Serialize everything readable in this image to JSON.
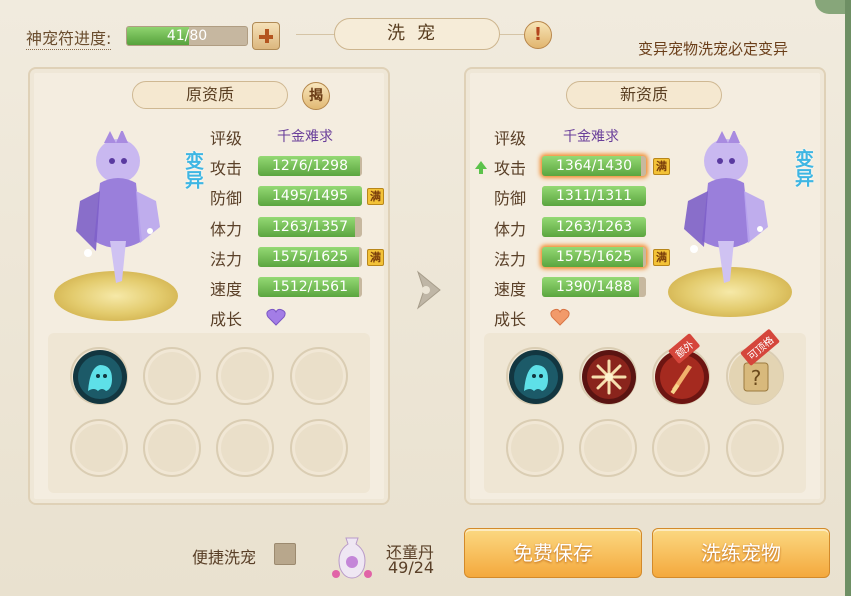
{
  "header": {
    "progress_label": "神宠符进度:",
    "progress_text": "41/80",
    "progress_fraction": 0.5125,
    "title": "洗宠",
    "mutation_note": "变异宠物洗宠必定变异"
  },
  "left_panel": {
    "header": "原资质",
    "reveal_label": "揭",
    "mutation_tag": "变异",
    "stats": [
      {
        "label": "评级",
        "value": "千金难求"
      },
      {
        "label": "攻击",
        "value": "1276/1298",
        "fraction": 0.983,
        "full": false
      },
      {
        "label": "防御",
        "value": "1495/1495",
        "fraction": 1.0,
        "full": true
      },
      {
        "label": "体力",
        "value": "1263/1357",
        "fraction": 0.931,
        "full": false
      },
      {
        "label": "法力",
        "value": "1575/1625",
        "fraction": 0.969,
        "full": true
      },
      {
        "label": "速度",
        "value": "1512/1561",
        "fraction": 0.969,
        "full": false
      },
      {
        "label": "成长",
        "value": "purple-heart-icon"
      }
    ],
    "skills": [
      "ghost-skill-icon",
      "",
      "",
      "",
      "",
      "",
      "",
      ""
    ]
  },
  "right_panel": {
    "header": "新资质",
    "mutation_tag": "变异",
    "stats": [
      {
        "label": "评级",
        "value": "千金难求"
      },
      {
        "label": "攻击",
        "value": "1364/1430",
        "fraction": 0.954,
        "full": true,
        "improved": true
      },
      {
        "label": "防御",
        "value": "1311/1311",
        "fraction": 1.0,
        "full": false
      },
      {
        "label": "体力",
        "value": "1263/1263",
        "fraction": 1.0,
        "full": false
      },
      {
        "label": "法力",
        "value": "1575/1625",
        "fraction": 0.969,
        "full": true
      },
      {
        "label": "速度",
        "value": "1390/1488",
        "fraction": 0.934,
        "full": false
      },
      {
        "label": "成长",
        "value": "orange-heart-icon"
      }
    ],
    "skills": [
      "ghost-skill-icon",
      "snowflake-skill-icon",
      "sword-skill-icon",
      "scroll-skill-icon",
      "",
      "",
      "",
      ""
    ],
    "skill_tags": {
      "extra": "额外",
      "top": "可顶格"
    }
  },
  "full_badge": "满",
  "bottom": {
    "quick_wash_label": "便捷洗宠",
    "item_name": "还童丹",
    "item_count": "49/24",
    "save_button": "免费保存",
    "wash_button": "洗练宠物"
  },
  "colors": {
    "bar_fill": "#5ba53f",
    "button_orange": "#f4a93d",
    "mutation_blue": "#3eb6e3",
    "rating_purple": "#6a3f9a"
  }
}
